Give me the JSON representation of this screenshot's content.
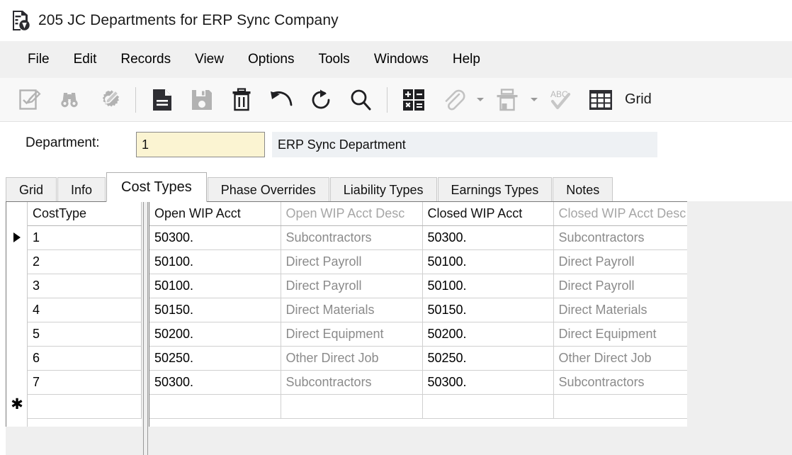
{
  "window": {
    "title": "205 JC Departments for ERP Sync Company",
    "icon": "department-document-icon"
  },
  "menu": {
    "items": [
      {
        "label": "File"
      },
      {
        "label": "Edit"
      },
      {
        "label": "Records"
      },
      {
        "label": "View"
      },
      {
        "label": "Options"
      },
      {
        "label": "Tools"
      },
      {
        "label": "Windows"
      },
      {
        "label": "Help"
      }
    ]
  },
  "toolbar": {
    "grid_label": "Grid",
    "buttons": [
      {
        "name": "edit-record-icon",
        "enabled": false
      },
      {
        "name": "find-binoculars-icon",
        "enabled": false
      },
      {
        "name": "find-settings-icon",
        "enabled": false
      },
      {
        "name": "new-record-icon",
        "enabled": true
      },
      {
        "name": "save-record-icon",
        "enabled": false
      },
      {
        "name": "delete-record-icon",
        "enabled": true
      },
      {
        "name": "undo-icon",
        "enabled": true
      },
      {
        "name": "refresh-icon",
        "enabled": true
      },
      {
        "name": "search-icon",
        "enabled": true
      },
      {
        "name": "calculator-icon",
        "enabled": true
      },
      {
        "name": "attachment-paperclip-icon",
        "enabled": false
      },
      {
        "name": "print-icon",
        "enabled": false
      },
      {
        "name": "spell-check-icon",
        "enabled": false
      },
      {
        "name": "grid-view-icon",
        "enabled": true
      }
    ]
  },
  "header_fields": {
    "department_label": "Department:",
    "department_value": "1",
    "department_placeholder": "",
    "department_description": "ERP Sync Department"
  },
  "tabs": {
    "active": "Cost Types",
    "items": [
      {
        "label": "Grid"
      },
      {
        "label": "Info"
      },
      {
        "label": "Cost Types"
      },
      {
        "label": "Phase Overrides"
      },
      {
        "label": "Liability Types"
      },
      {
        "label": "Earnings Types"
      },
      {
        "label": "Notes"
      }
    ]
  },
  "grid": {
    "fixed_columns": [
      {
        "key": "cost_type",
        "label": "CostType",
        "align": "right",
        "dim": false
      }
    ],
    "scroll_columns": [
      {
        "key": "open_wip_acct",
        "label": "Open WIP Acct",
        "align": "left",
        "dim": false
      },
      {
        "key": "open_wip_acct_desc",
        "label": "Open WIP Acct Desc",
        "align": "left",
        "dim": true
      },
      {
        "key": "closed_wip_acct",
        "label": "Closed WIP Acct",
        "align": "left",
        "dim": false
      },
      {
        "key": "closed_wip_acct_desc",
        "label": "Closed WIP Acct Desc",
        "align": "left",
        "dim": true
      }
    ],
    "rows": [
      {
        "marker": "current",
        "cost_type": "1",
        "open_wip_acct": "50300.",
        "open_wip_acct_desc": "Subcontractors",
        "closed_wip_acct": "50300.",
        "closed_wip_acct_desc": "Subcontractors"
      },
      {
        "marker": "",
        "cost_type": "2",
        "open_wip_acct": "50100.",
        "open_wip_acct_desc": "Direct Payroll",
        "closed_wip_acct": "50100.",
        "closed_wip_acct_desc": "Direct Payroll"
      },
      {
        "marker": "",
        "cost_type": "3",
        "open_wip_acct": "50100.",
        "open_wip_acct_desc": "Direct Payroll",
        "closed_wip_acct": "50100.",
        "closed_wip_acct_desc": "Direct Payroll"
      },
      {
        "marker": "",
        "cost_type": "4",
        "open_wip_acct": "50150.",
        "open_wip_acct_desc": "Direct Materials",
        "closed_wip_acct": "50150.",
        "closed_wip_acct_desc": "Direct Materials"
      },
      {
        "marker": "",
        "cost_type": "5",
        "open_wip_acct": "50200.",
        "open_wip_acct_desc": "Direct Equipment",
        "closed_wip_acct": "50200.",
        "closed_wip_acct_desc": "Direct Equipment"
      },
      {
        "marker": "",
        "cost_type": "6",
        "open_wip_acct": "50250.",
        "open_wip_acct_desc": "Other Direct Job",
        "closed_wip_acct": "50250.",
        "closed_wip_acct_desc": "Other Direct Job"
      },
      {
        "marker": "",
        "cost_type": "7",
        "open_wip_acct": "50300.",
        "open_wip_acct_desc": "Subcontractors",
        "closed_wip_acct": "50300.",
        "closed_wip_acct_desc": "Subcontractors"
      },
      {
        "marker": "new",
        "cost_type": "",
        "open_wip_acct": "",
        "open_wip_acct_desc": "",
        "closed_wip_acct": "",
        "closed_wip_acct_desc": ""
      }
    ]
  },
  "colors": {
    "editable_field_bg": "#fbf4d2",
    "readonly_field_bg": "#eef1f4",
    "chrome_bg": "#f0f0f0",
    "panel_bg": "#efefef",
    "dim_text": "#8b8b8b"
  }
}
